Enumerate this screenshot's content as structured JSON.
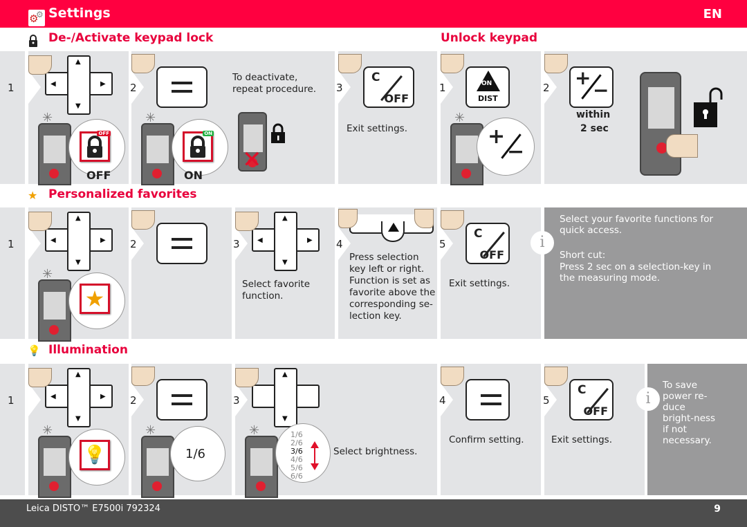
{
  "header": {
    "title": "Settings",
    "language": "EN",
    "accent": "#ff0040"
  },
  "sections": {
    "keypad_lock": {
      "title": "De-/Activate keypad lock",
      "steps": [
        {
          "num": "1",
          "badge": "OFF",
          "caption": "OFF"
        },
        {
          "num": "2",
          "badge": "ON",
          "caption": "ON",
          "text": "To deactivate, repeat procedure."
        },
        {
          "num": "3",
          "text": "Exit settings."
        }
      ]
    },
    "unlock_keypad": {
      "title": "Unlock keypad",
      "steps": [
        {
          "num": "1",
          "key_top": "ON",
          "key_bottom": "DIST"
        },
        {
          "num": "2",
          "text_line1": "within",
          "text_line2": "2 sec"
        }
      ]
    },
    "favorites": {
      "title": "Personalized favorites",
      "steps": [
        {
          "num": "1"
        },
        {
          "num": "2"
        },
        {
          "num": "3",
          "text": "Select favorite function."
        },
        {
          "num": "4",
          "text": "Press selection key left or right. Function is set as favorite above the corresponding se-lection key."
        },
        {
          "num": "5",
          "text": "Exit settings."
        }
      ],
      "info_line1": "Select your favorite functions for quick access.",
      "info_line2": "Short cut:",
      "info_line3": "Press 2 sec on a selection-key in the measuring mode."
    },
    "illumination": {
      "title": "Illumination",
      "steps": [
        {
          "num": "1"
        },
        {
          "num": "2",
          "bubble": "1/6"
        },
        {
          "num": "3",
          "text": "Select brightness.",
          "levels": [
            "1/6",
            "2/6",
            "3/6",
            "4/6",
            "5/6",
            "6/6"
          ],
          "selected": "3/6"
        },
        {
          "num": "4",
          "text": "Confirm setting."
        },
        {
          "num": "5",
          "text": "Exit settings."
        }
      ],
      "info": "To save power re-duce bright-ness if not necessary."
    }
  },
  "keys": {
    "c": "C",
    "off": "OFF",
    "arrow_up": "▲",
    "arrow_down": "▼",
    "arrow_left": "◀",
    "arrow_right": "▶",
    "plus": "+",
    "minus": "−",
    "info": "i"
  },
  "footer": {
    "product": "Leica DISTO™ E7500i 792324",
    "page": "9"
  }
}
